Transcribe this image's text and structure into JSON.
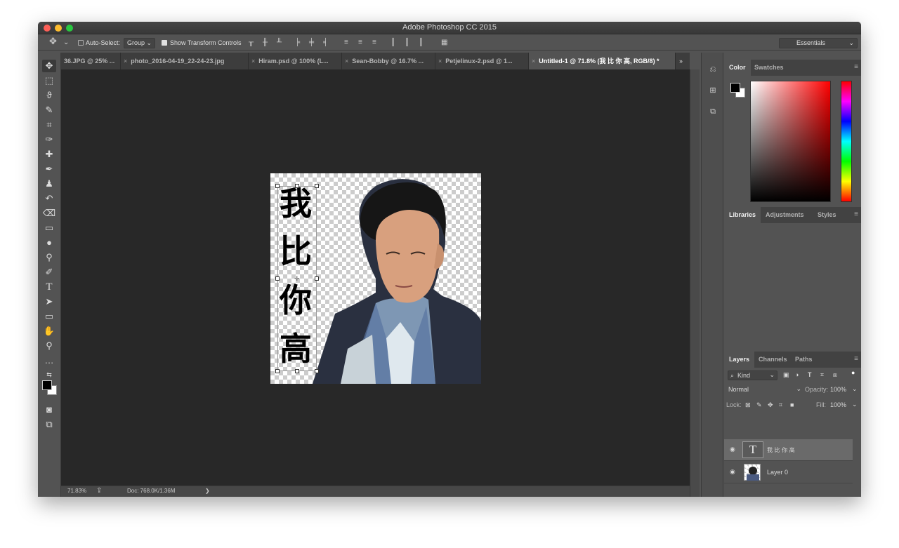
{
  "app": {
    "title": "Adobe Photoshop CC 2015"
  },
  "options_bar": {
    "auto_select_label": "Auto-Select:",
    "auto_select_value": "Group",
    "show_transform_label": "Show Transform Controls",
    "workspace": "Essentials"
  },
  "tabs": [
    "36.JPG @ 25% ...",
    "photo_2016-04-19_22-24-23.jpg",
    "Hiram.psd @ 100% (L...",
    "Sean-Bobby @ 16.7% ...",
    "Petjelinux-2.psd @ 1...",
    "Untitled-1 @ 71.8% (我 比 你 高, RGB/8) *"
  ],
  "tab_overflow": "»",
  "canvas": {
    "chars": [
      "我",
      "比",
      "你",
      "高"
    ]
  },
  "status": {
    "zoom": "71.83%",
    "doc": "Doc: 768.0K/1.36M",
    "arrow": "❯"
  },
  "color_panel": {
    "tabs": [
      "Color",
      "Swatches"
    ]
  },
  "libraries_panel": {
    "tabs": [
      "Libraries",
      "Adjustments",
      "Styles"
    ]
  },
  "layers_panel": {
    "tabs": [
      "Layers",
      "Channels",
      "Paths"
    ],
    "filter_label": "Kind",
    "blend_mode": "Normal",
    "opacity_label": "Opacity:",
    "opacity_value": "100%",
    "lock_label": "Lock:",
    "fill_label": "Fill:",
    "fill_value": "100%",
    "layers": [
      {
        "name": "我 比 你 高",
        "type": "text"
      },
      {
        "name": "Layer 0",
        "type": "image"
      }
    ]
  },
  "colors": {
    "accent_hue_bar": "#ff0000",
    "foreground": "#000000",
    "background": "#ffffff"
  }
}
